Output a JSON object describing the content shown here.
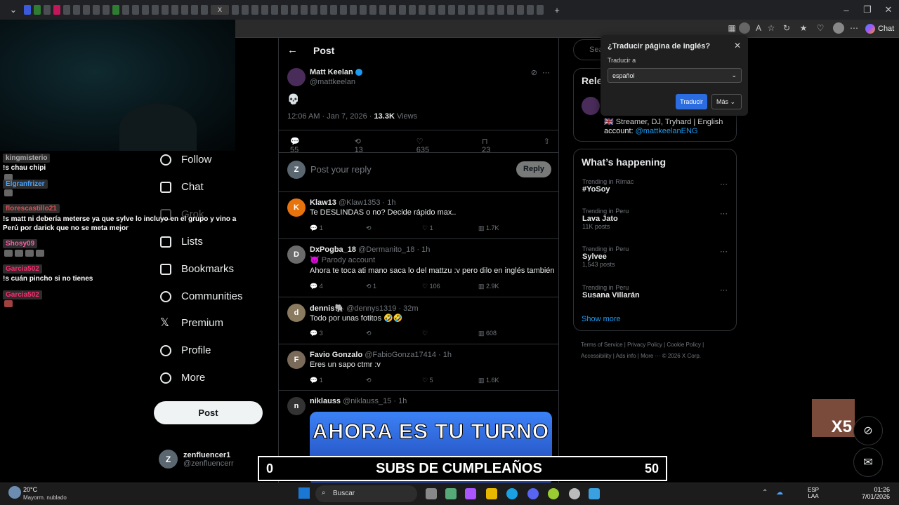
{
  "browser": {
    "active_tab_label": "X",
    "new_tab_symbol": "+",
    "chat_button": "Chat"
  },
  "chat_overlay": [
    {
      "user": "kingmisterio",
      "message": "!s chau chipi",
      "color": "#b0b0b0"
    },
    {
      "user": "Elgranfrizer",
      "message": "",
      "color": "#4aa3ff"
    },
    {
      "user": "florescastillo21",
      "message": "!s matt ni debería meterse ya que sylve lo incluyo en el grupo y vino a Perú por darick que no se meta mejor",
      "color": "#e05050"
    },
    {
      "user": "Shosy09",
      "message": "",
      "color": "#ff5ca8"
    },
    {
      "user": "Garcia502",
      "message": "!s cuán pincho si no tienes",
      "color": "#ff2a6d"
    },
    {
      "user": "Garcia502",
      "message": "",
      "color": "#ff2a6d"
    }
  ],
  "nav": {
    "follow": "Follow",
    "chat": "Chat",
    "grok": "Grok",
    "lists": "Lists",
    "bookmarks": "Bookmarks",
    "communities": "Communities",
    "premium": "Premium",
    "profile": "Profile",
    "more": "More",
    "post_button": "Post",
    "account_name": "zenfluencer1",
    "account_handle": "@zenfluencerr",
    "account_initial": "Z"
  },
  "post": {
    "header": "Post",
    "author_name": "Matt Keelan",
    "author_handle": "@mattkeelan",
    "content": "💀",
    "timestamp": "12:06 AM · Jan 7, 2026 · ",
    "views": "13.3K",
    "views_label": " Views",
    "replies": "55",
    "reposts": "13",
    "likes": "635",
    "bookmarks": "23",
    "reply_placeholder": "Post your reply",
    "reply_button": "Reply",
    "reply_avatar": "Z"
  },
  "replies": [
    {
      "name": "Klaw13",
      "handle": "@Klaw1353 · 1h",
      "text": "Te DESLINDAS o no? Decide rápido max..",
      "avatar": "K",
      "avatar_color": "#e8730c",
      "replies": "1",
      "reposts": "",
      "likes": "1",
      "views": "1.7K",
      "extra": ""
    },
    {
      "name": "DxPogba_18",
      "handle": "@Dermanito_18 · 1h",
      "text": "Ahora te toca ati mano saca lo del mattzu :v pero dilo en inglés también",
      "avatar": "D",
      "avatar_color": "#6b6b6b",
      "replies": "4",
      "reposts": "1",
      "likes": "106",
      "views": "2.9K",
      "extra": "😈 Parody account"
    },
    {
      "name": "dennis🐘",
      "handle": "@dennys1319 · 32m",
      "text": "Todo por unas fotitos 🤣🤣",
      "avatar": "d",
      "avatar_color": "#8a7a60",
      "replies": "3",
      "reposts": "",
      "likes": "",
      "views": "608",
      "extra": ""
    },
    {
      "name": "Favio Gonzalo",
      "handle": "@FabioGonza17414 · 1h",
      "text": "Eres un sapo ctmr :v",
      "avatar": "F",
      "avatar_color": "#7a6a5a",
      "replies": "1",
      "reposts": "",
      "likes": "5",
      "views": "1.6K",
      "extra": ""
    },
    {
      "name": "niklauss",
      "handle": "@niklauss_15 · 1h",
      "text": "",
      "avatar": "n",
      "avatar_color": "#333",
      "replies": "",
      "reposts": "",
      "likes": "",
      "views": "",
      "extra": ""
    }
  ],
  "meme_text": "AHORA ES TU TURNO",
  "right": {
    "search_placeholder": "Sea",
    "relevant_title": "Rele",
    "relevant_bio": "🇬🇧 Streamer, DJ, Tryhard | English account: ",
    "relevant_link": "@mattkeelanENG",
    "happening_title": "What’s happening",
    "trends": [
      {
        "context": "Trending in Rímac",
        "title": "#YoSoy",
        "count": ""
      },
      {
        "context": "Trending in Peru",
        "title": "Lava Jato",
        "count": "11K posts"
      },
      {
        "context": "Trending in Peru",
        "title": "Sylvee",
        "count": "1,543 posts"
      },
      {
        "context": "Trending in Peru",
        "title": "Susana Villarán",
        "count": ""
      }
    ],
    "show_more": "Show more",
    "footer1": "Terms of Service  |  Privacy Policy  |  Cookie Policy  |",
    "footer2": "Accessibility  |  Ads info  |  More ···  © 2026 X Corp."
  },
  "translate": {
    "title": "¿Traducir página de inglés?",
    "label": "Traducir a",
    "language": "español",
    "translate_button": "Traducir",
    "more_button": "Más"
  },
  "banner": {
    "left": "0",
    "center": "SUBS DE CUMPLEAÑOS",
    "right": "50"
  },
  "multiplier": "X5",
  "taskbar": {
    "weather_temp": "20°C",
    "weather_desc": "Mayorm. nublado",
    "search_label": "Buscar",
    "lang1": "ESP",
    "lang2": "LAA",
    "time": "01:26",
    "date": "7/01/2026"
  }
}
